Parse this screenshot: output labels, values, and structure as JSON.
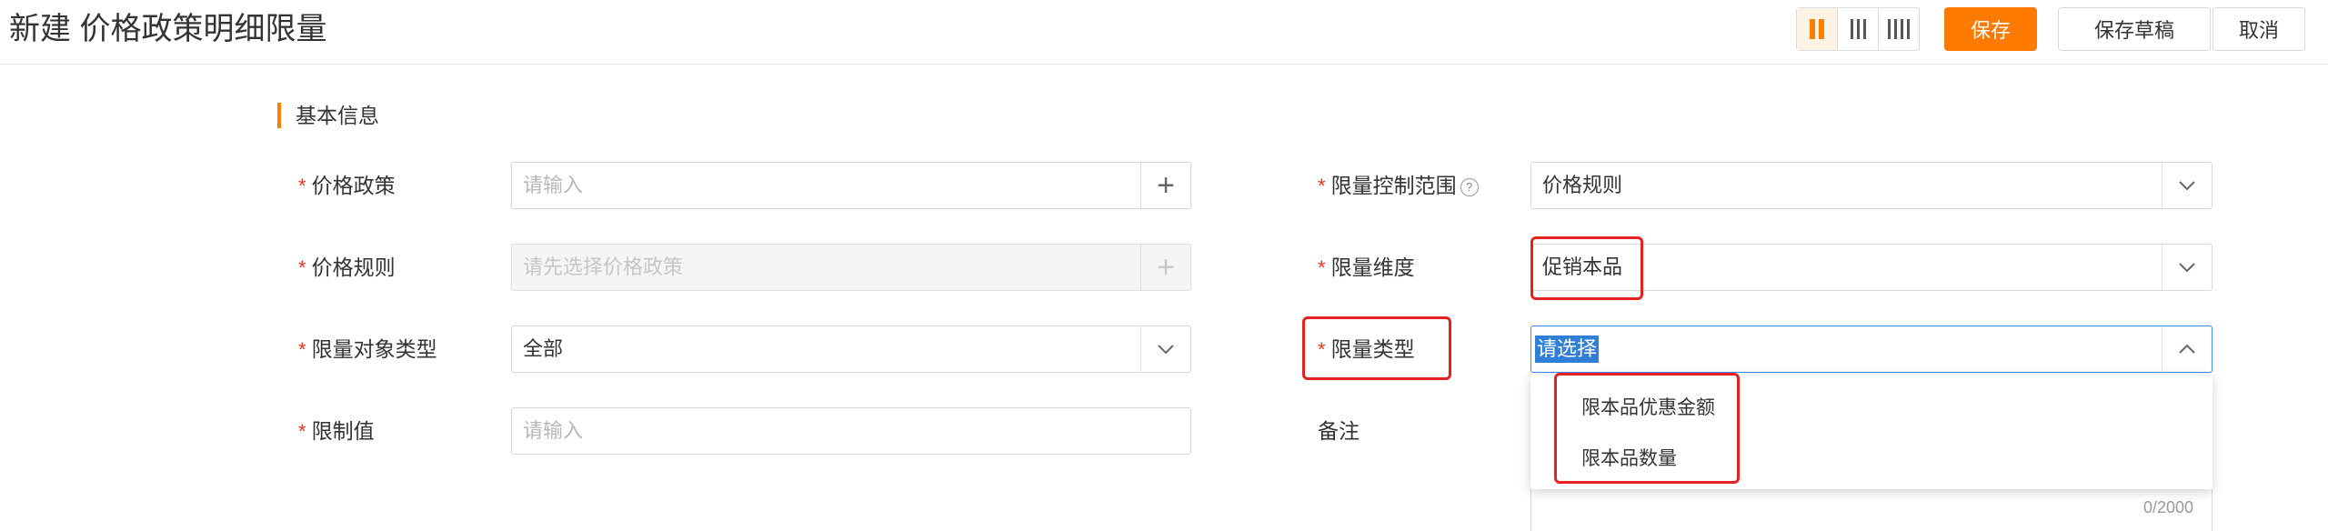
{
  "header": {
    "title": "新建 价格政策明细限量",
    "save_label": "保存",
    "save_draft_label": "保存草稿",
    "cancel_label": "取消"
  },
  "section": {
    "title": "基本信息"
  },
  "form": {
    "price_policy": {
      "label": "价格政策",
      "placeholder": "请输入"
    },
    "price_rule": {
      "label": "价格规则",
      "placeholder": "请先选择价格政策"
    },
    "limit_object_type": {
      "label": "限量对象类型",
      "value": "全部"
    },
    "limit_value": {
      "label": "限制值",
      "placeholder": "请输入"
    },
    "limit_control_scope": {
      "label": "限量控制范围",
      "value": "价格规则"
    },
    "limit_dimension": {
      "label": "限量维度",
      "value": "促销本品"
    },
    "limit_type": {
      "label": "限量类型",
      "placeholder": "请选择"
    },
    "remark": {
      "label": "备注",
      "counter": "0/2000"
    }
  },
  "dropdown": {
    "options": [
      "限本品优惠金额",
      "限本品数量"
    ]
  },
  "colors": {
    "accent": "#ff7a00",
    "required": "#e8361d",
    "highlight": "#e52121",
    "focus": "#3d8bfd"
  },
  "icons": [
    "layout-two-column-icon",
    "layout-three-column-icon",
    "layout-four-column-icon",
    "plus-icon",
    "chevron-down-icon",
    "chevron-up-icon",
    "help-icon"
  ]
}
